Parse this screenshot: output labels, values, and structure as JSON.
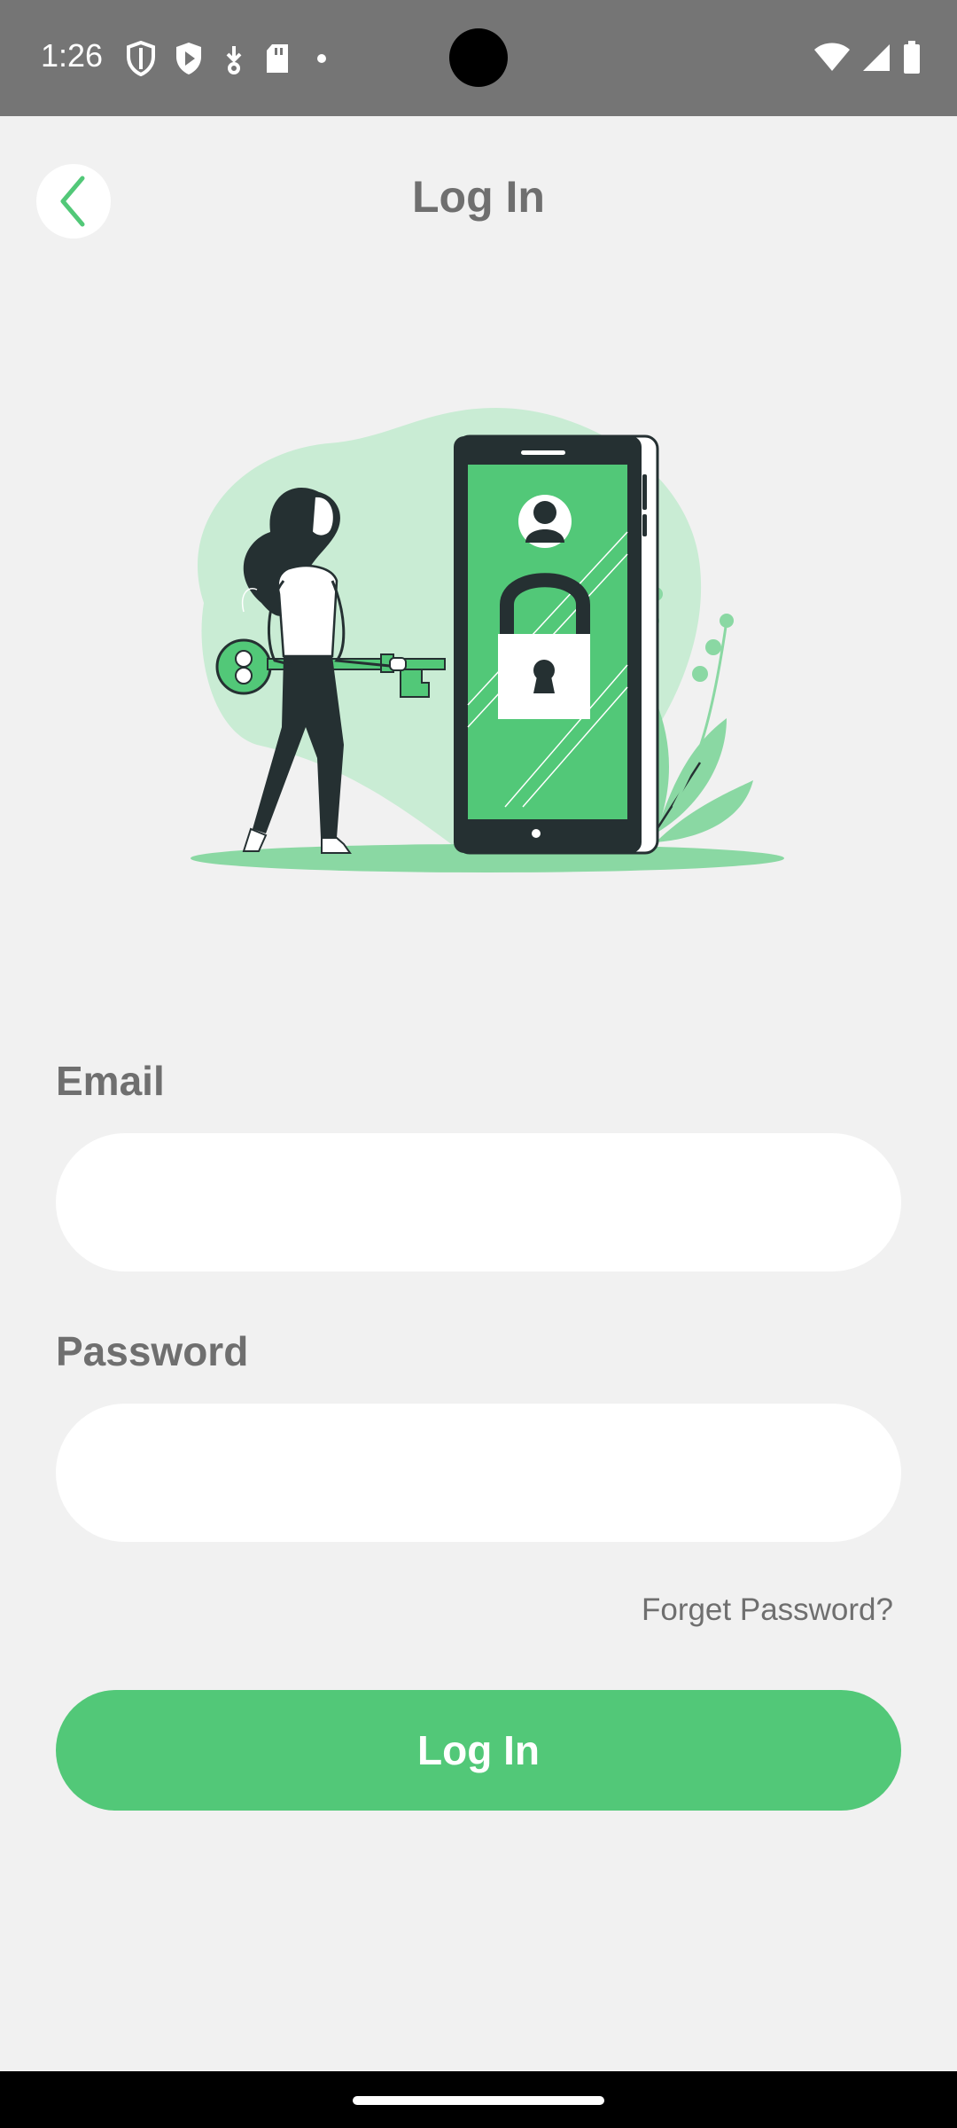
{
  "status_bar": {
    "time": "1:26",
    "left_icons": [
      "shield-icon",
      "play-protect-icon",
      "download-icon",
      "sd-card-icon",
      "dot-icon"
    ],
    "right_icons": [
      "wifi-icon",
      "signal-icon",
      "battery-icon"
    ]
  },
  "header": {
    "title": "Log In",
    "back_icon": "chevron-left-icon"
  },
  "illustration": {
    "icon": "login-illustration"
  },
  "form": {
    "email_label": "Email",
    "email_value": "",
    "email_placeholder": "",
    "password_label": "Password",
    "password_value": "",
    "password_placeholder": "",
    "forgot_label": "Forget Password?",
    "submit_label": "Log In"
  },
  "colors": {
    "accent": "#52c878",
    "background": "#f1f1f1",
    "label_text": "#6f6f6f",
    "status_bar": "#757575"
  }
}
